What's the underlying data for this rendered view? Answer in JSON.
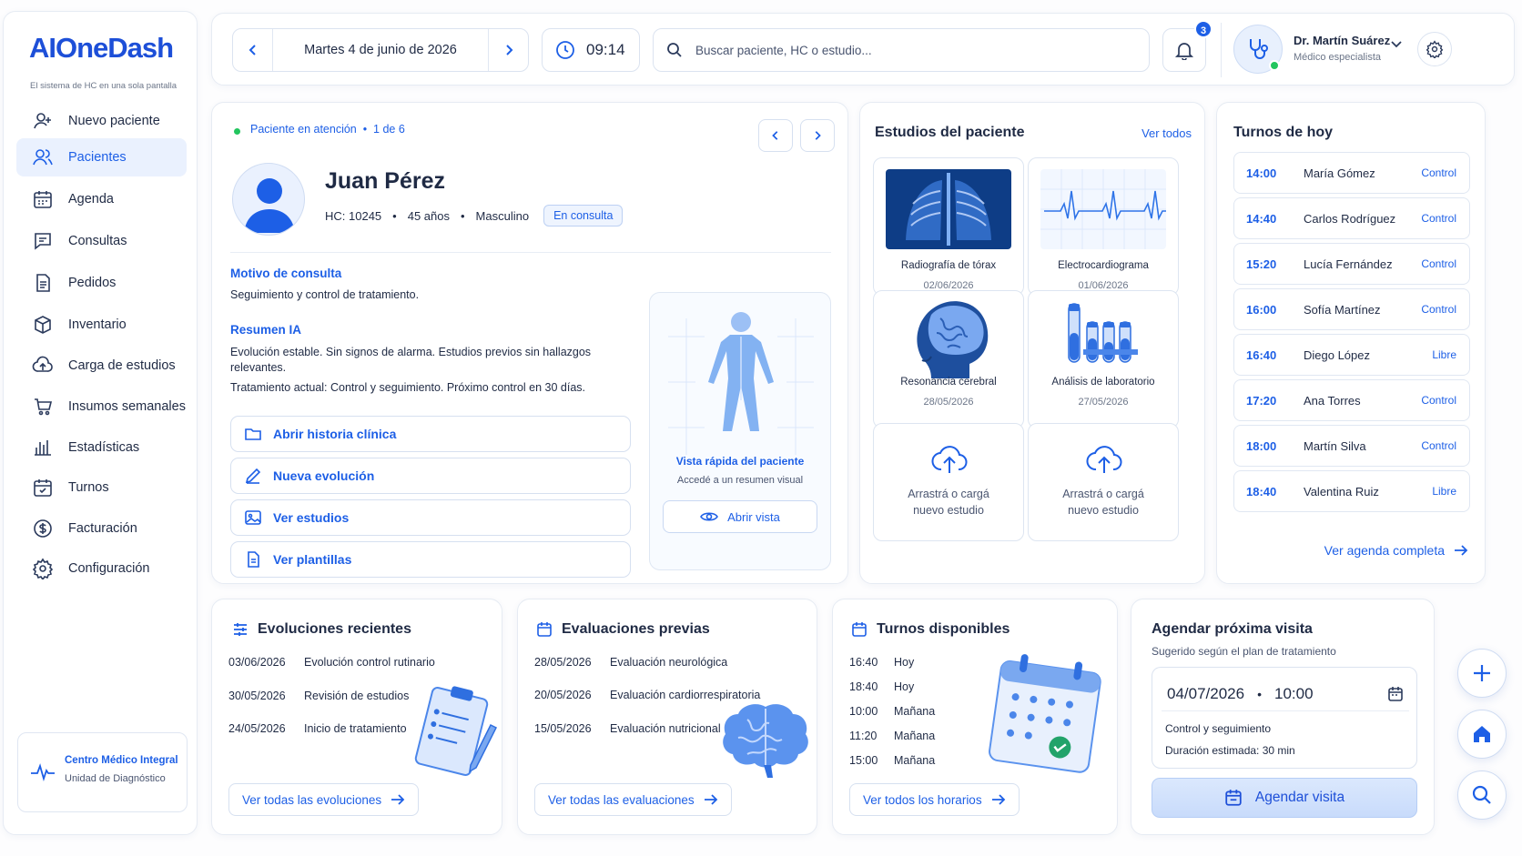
{
  "brand": {
    "name": "AIOneDash",
    "tagline": "El sistema de HC en una sola pantalla"
  },
  "sidebar": {
    "items": [
      {
        "label": "Nuevo paciente",
        "icon": "user-plus-icon"
      },
      {
        "label": "Pacientes",
        "icon": "users-icon",
        "active": true
      },
      {
        "label": "Agenda",
        "icon": "calendar-icon"
      },
      {
        "label": "Consultas",
        "icon": "chat-icon"
      },
      {
        "label": "Pedidos",
        "icon": "document-icon"
      },
      {
        "label": "Inventario",
        "icon": "box-icon"
      },
      {
        "label": "Carga de estudios",
        "icon": "cloud-upload-icon"
      },
      {
        "label": "Insumos semanales",
        "icon": "cart-icon"
      },
      {
        "label": "Estadísticas",
        "icon": "bar-chart-icon"
      },
      {
        "label": "Turnos",
        "icon": "calendar-check-icon"
      },
      {
        "label": "Facturación",
        "icon": "dollar-icon"
      },
      {
        "label": "Configuración",
        "icon": "gear-icon"
      }
    ],
    "clinic": {
      "name": "Centro Médico Integral",
      "unit": "Unidad de Diagnóstico"
    }
  },
  "topbar": {
    "date": "Martes 4 de junio de 2026",
    "time": "09:14",
    "search_placeholder": "Buscar paciente, HC o estudio...",
    "notifications": "3",
    "user_name": "Dr. Martín Suárez",
    "user_role": "Médico especialista"
  },
  "patient": {
    "status": "Paciente en atención",
    "position": "1 de 6",
    "name": "Juan Pérez",
    "hc": "HC: 10245",
    "age": "45 años",
    "sex": "Masculino",
    "badge": "En consulta",
    "motivo_title": "Motivo de consulta",
    "motivo": "Seguimiento y control de tratamiento.",
    "resumen_title": "Resumen IA",
    "resumen_1": "Evolución estable. Sin signos de alarma. Estudios previos sin hallazgos relevantes.",
    "resumen_2": "Tratamiento actual: Control y seguimiento. Próximo control en 30 días.",
    "actions": [
      {
        "label": "Abrir historia clínica"
      },
      {
        "label": "Nueva evolución"
      },
      {
        "label": "Ver estudios"
      },
      {
        "label": "Ver plantillas"
      }
    ],
    "quickview": {
      "title": "Vista rápida del paciente",
      "subtitle": "Accedé a un resumen visual",
      "button": "Abrir vista"
    }
  },
  "studies": {
    "title": "Estudios del paciente",
    "view_all": "Ver todos",
    "items": [
      {
        "title": "Radiografía de tórax",
        "date": "02/06/2026"
      },
      {
        "title": "Electrocardiograma",
        "date": "01/06/2026"
      },
      {
        "title": "Resonancia cerebral",
        "date": "28/05/2026"
      },
      {
        "title": "Análisis de laboratorio",
        "date": "27/05/2026"
      }
    ],
    "upload_1": "Arrastrá o cargá",
    "upload_2": "nuevo estudio"
  },
  "turnos": {
    "title": "Turnos de hoy",
    "rows": [
      {
        "time": "14:00",
        "name": "María Gómez",
        "status": "Control"
      },
      {
        "time": "14:40",
        "name": "Carlos Rodríguez",
        "status": "Control"
      },
      {
        "time": "15:20",
        "name": "Lucía Fernández",
        "status": "Control"
      },
      {
        "time": "16:00",
        "name": "Sofía Martínez",
        "status": "Control"
      },
      {
        "time": "16:40",
        "name": "Diego López",
        "status": "Libre"
      },
      {
        "time": "17:20",
        "name": "Ana Torres",
        "status": "Control"
      },
      {
        "time": "18:00",
        "name": "Martín Silva",
        "status": "Control"
      },
      {
        "time": "18:40",
        "name": "Valentina Ruiz",
        "status": "Libre"
      }
    ],
    "link": "Ver agenda completa"
  },
  "evoluciones": {
    "title": "Evoluciones recientes",
    "rows": [
      {
        "date": "03/06/2026",
        "text": "Evolución control rutinario"
      },
      {
        "date": "30/05/2026",
        "text": "Revisión de estudios"
      },
      {
        "date": "24/05/2026",
        "text": "Inicio de tratamiento"
      }
    ],
    "link": "Ver todas las evoluciones"
  },
  "evaluaciones": {
    "title": "Evaluaciones previas",
    "rows": [
      {
        "date": "28/05/2026",
        "text": "Evaluación neurológica"
      },
      {
        "date": "20/05/2026",
        "text": "Evaluación cardiorrespiratoria"
      },
      {
        "date": "15/05/2026",
        "text": "Evaluación nutricional"
      }
    ],
    "link": "Ver todas las evaluaciones"
  },
  "disponibles": {
    "title": "Turnos disponibles",
    "rows": [
      {
        "time": "16:40",
        "day": "Hoy"
      },
      {
        "time": "18:40",
        "day": "Hoy"
      },
      {
        "time": "10:00",
        "day": "Mañana"
      },
      {
        "time": "11:20",
        "day": "Mañana"
      },
      {
        "time": "15:00",
        "day": "Mañana"
      }
    ],
    "link": "Ver todos los horarios"
  },
  "agendar": {
    "title": "Agendar próxima visita",
    "subtitle": "Sugerido según el plan de tratamiento",
    "date": "04/07/2026",
    "time": "10:00",
    "type": "Control y seguimiento",
    "duration": "Duración estimada: 30 min",
    "button": "Agendar visita"
  },
  "colors": {
    "accent": "#1d5fe6",
    "active_bg": "#eaf1fe",
    "status_dot": "#22c55e"
  }
}
